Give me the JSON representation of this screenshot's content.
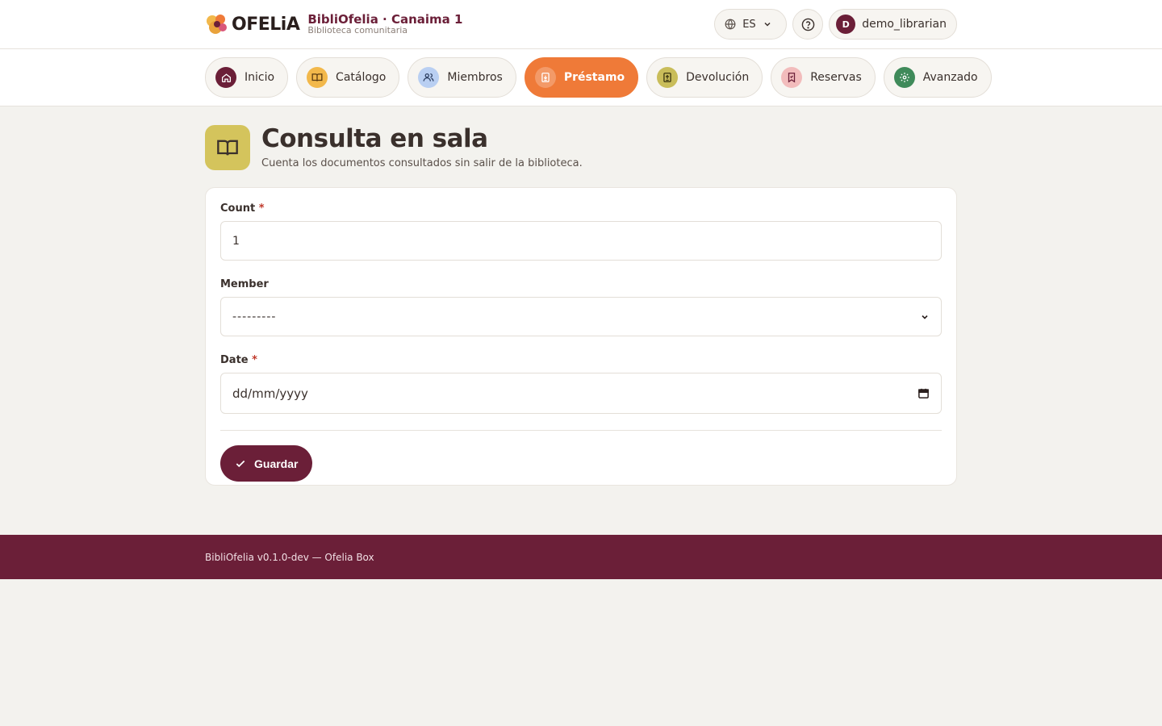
{
  "header": {
    "logo_text": "OFELiA",
    "app_title": "BibliOfelia · Canaima 1",
    "app_subtitle": "Biblioteca comunitaria",
    "language": "ES",
    "user_initial": "D",
    "username": "demo_librarian"
  },
  "nav": {
    "items": [
      {
        "label": "Inicio",
        "icon": "home-icon",
        "color": "#6b1f38"
      },
      {
        "label": "Catálogo",
        "icon": "book-icon",
        "color": "#f2b84b"
      },
      {
        "label": "Miembros",
        "icon": "users-icon",
        "color": "#b9cff2"
      },
      {
        "label": "Préstamo",
        "icon": "loan-icon",
        "color": "#f39a68"
      },
      {
        "label": "Devolución",
        "icon": "return-icon",
        "color": "#c9bd5a"
      },
      {
        "label": "Reservas",
        "icon": "bookmark-icon",
        "color": "#f2bcbc"
      },
      {
        "label": "Avanzado",
        "icon": "gear-icon",
        "color": "#3f8a5a"
      }
    ],
    "active": "Préstamo"
  },
  "page": {
    "title": "Consulta en sala",
    "subtitle": "Cuenta los documentos consultados sin salir de la biblioteca.",
    "icon": "open-book-icon"
  },
  "form": {
    "count_label": "Count",
    "count_value": "1",
    "member_label": "Member",
    "member_value": "---------",
    "date_label": "Date",
    "date_placeholder": "dd/mm/yyyy",
    "required_mark": "*",
    "save_label": "Guardar"
  },
  "footer": {
    "text": "BibliOfelia v0.1.0-dev — Ofelia Box"
  },
  "colors": {
    "brand": "#6b1f38",
    "accent": "#ef7a38",
    "background": "#f3f2ee"
  }
}
